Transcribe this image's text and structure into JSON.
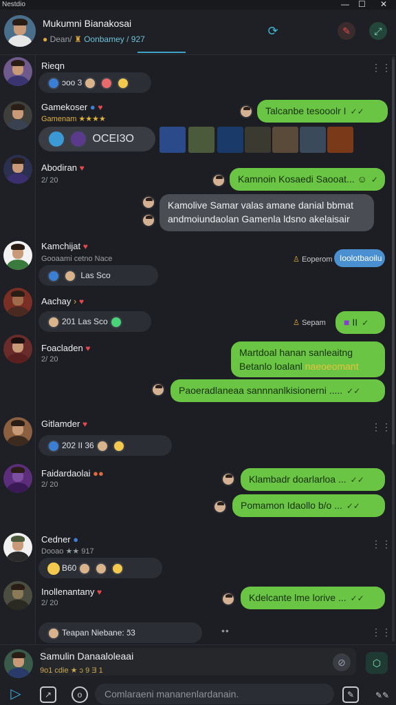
{
  "window": {
    "title": "Nestdio",
    "min": "—",
    "max": "☐",
    "close": "✕"
  },
  "header": {
    "name": "Mukumni Bianakosai",
    "sub_prefix": "Dean/",
    "sub_group": "Oonbamey",
    "sub_suffix": "/ 927",
    "accent": "#3fa3c7"
  },
  "messages": [
    {
      "name": "Rieqn",
      "chip": "ɔoo 3"
    },
    {
      "name": "Gamekoser",
      "sub": "Gamenam ★★★★",
      "chip": "OCEI3O",
      "bubble": "Talcanbe tesooolr I"
    },
    {
      "name": "Abodiran",
      "sub": "2/ 20",
      "bubble": "Kamnoin Kosaedi Saooat...",
      "bubble2_l1": "Kamolive Samar valas amane danial bbmat",
      "bubble2_l2": "andmoiundaolan Gamenla ldsno akelaisair"
    },
    {
      "name": "Kamchijat",
      "sub": "Gooaami  cetno Nace",
      "chip": "Las Sco",
      "tag": "Eoperom",
      "pill": "Ioolotbaoilu"
    },
    {
      "name": "Aachay",
      "chip": "201  Las Sco",
      "tag": "Sepam",
      "bubble": "II"
    },
    {
      "name": "Foacladen",
      "sub": "2/ 20",
      "bubble_l1": "Martdoal hanan sanleaitng",
      "bubble_l2": "Betanlo loalanl",
      "bubble_l2_hl": "naeoeomant",
      "bubble2": "Paoeradlaneaa sannnanlkisionerni ....."
    },
    {
      "name": "Gitlamder",
      "chip": "202  II  36"
    },
    {
      "name": "Faidardaolai",
      "sub": "2/ 20",
      "bubble": "Klambadr doarlarloa ...",
      "bubble2": "Pomamon Idaollo b/o ..."
    },
    {
      "name": "Cedner",
      "sub": "Dooao ★★ 917",
      "chip": "B60"
    },
    {
      "name": "Inollenantany",
      "sub": "2/ 20",
      "bubble": "Kdelcante lme lorive ...",
      "chip": "Teapan Niebane:   ɔ̃3"
    }
  ],
  "composer": {
    "name": "Samulin Danaaloleaai",
    "sub": "9o1   cdie ★ ɔ 9   Ǝ 1",
    "placeholder": "Comlaraeni mananenlardanain."
  },
  "colors": {
    "bubble_green": "#6bc544",
    "bubble_gray": "#4a4d53",
    "pill_blue": "#4a90d1",
    "heart": "#e5484d"
  }
}
